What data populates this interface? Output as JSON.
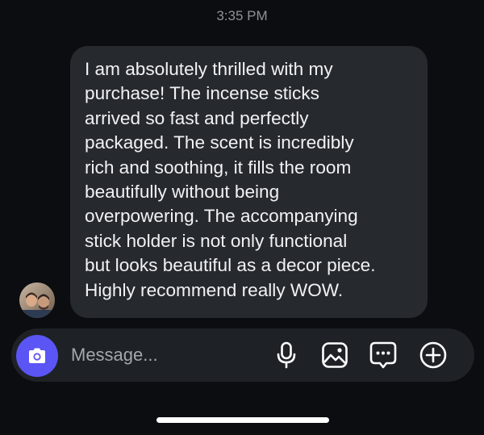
{
  "header": {
    "timestamp": "3:35 PM"
  },
  "message": {
    "text": "I am absolutely thrilled with my\npurchase! The incense sticks\narrived so fast and perfectly\npackaged. The scent is incredibly\nrich and soothing, it fills the room\nbeautifully without being\noverpowering. The accompanying\nstick holder is not only functional\nbut looks beautiful as a decor piece.\nHighly recommend really WOW.",
    "bubble_color": "#262a2f",
    "sender_avatar": "avatar"
  },
  "composer": {
    "placeholder": "Message...",
    "value": "",
    "camera_button_color": "#5b55f5",
    "icons": [
      "camera-icon",
      "microphone-icon",
      "gallery-icon",
      "sticker-icon",
      "plus-icon"
    ]
  },
  "theme": {
    "background": "#0b0d10",
    "accent": "#5b55f5"
  }
}
